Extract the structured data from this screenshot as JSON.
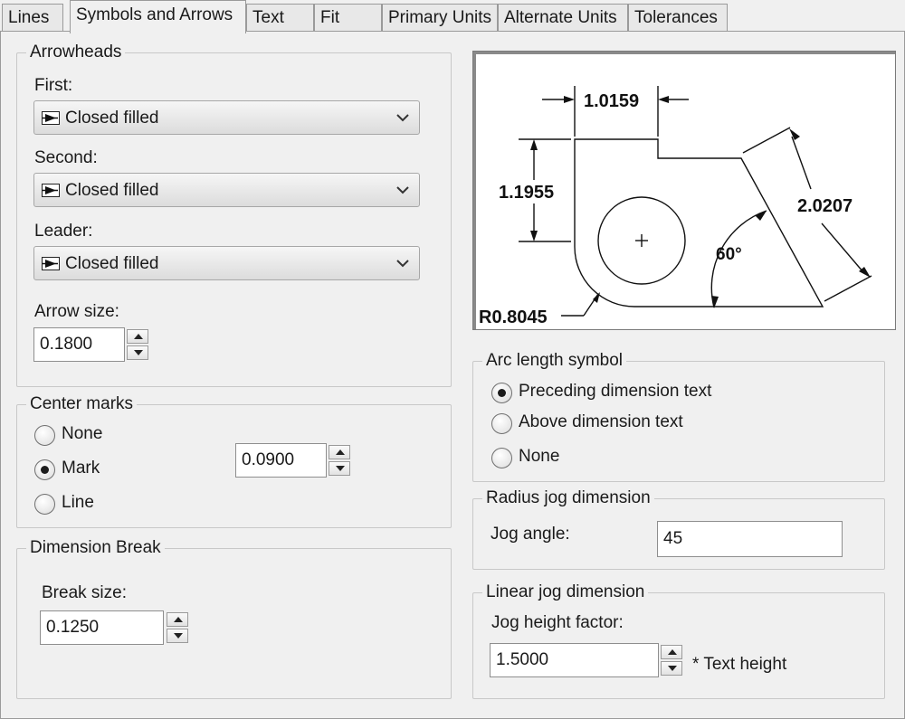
{
  "tabs": [
    {
      "label": "Lines"
    },
    {
      "label": "Symbols and Arrows"
    },
    {
      "label": "Text"
    },
    {
      "label": "Fit"
    },
    {
      "label": "Primary Units"
    },
    {
      "label": "Alternate Units"
    },
    {
      "label": "Tolerances"
    }
  ],
  "active_tab": "Symbols and Arrows",
  "arrowheads": {
    "title": "Arrowheads",
    "first_label": "First:",
    "first_value": "Closed filled",
    "second_label": "Second:",
    "second_value": "Closed filled",
    "leader_label": "Leader:",
    "leader_value": "Closed filled",
    "size_label": "Arrow size:",
    "size_value": "0.1800"
  },
  "center_marks": {
    "title": "Center marks",
    "options": [
      {
        "label": "None",
        "selected": false
      },
      {
        "label": "Mark",
        "selected": true
      },
      {
        "label": "Line",
        "selected": false
      }
    ],
    "size_value": "0.0900"
  },
  "dimension_break": {
    "title": "Dimension Break",
    "size_label": "Break size:",
    "size_value": "0.1250"
  },
  "preview": {
    "dim_top": "1.0159",
    "dim_left": "1.1955",
    "dim_right": "2.0207",
    "angle": "60°",
    "radius": "R0.8045"
  },
  "arc_length": {
    "title": "Arc length symbol",
    "options": [
      {
        "label": "Preceding dimension text",
        "selected": true
      },
      {
        "label": "Above dimension text",
        "selected": false
      },
      {
        "label": "None",
        "selected": false
      }
    ]
  },
  "radius_jog": {
    "title": "Radius jog dimension",
    "angle_label": "Jog angle:",
    "angle_value": "45"
  },
  "linear_jog": {
    "title": "Linear jog dimension",
    "factor_label": "Jog height factor:",
    "factor_value": "1.5000",
    "suffix": "* Text height"
  },
  "icons": {
    "arrow": "closed-filled-arrow-icon",
    "dropdown": "chevron-down-icon",
    "spinner": "spinner-arrows-icon",
    "center_mark": "crosshair-icon"
  }
}
